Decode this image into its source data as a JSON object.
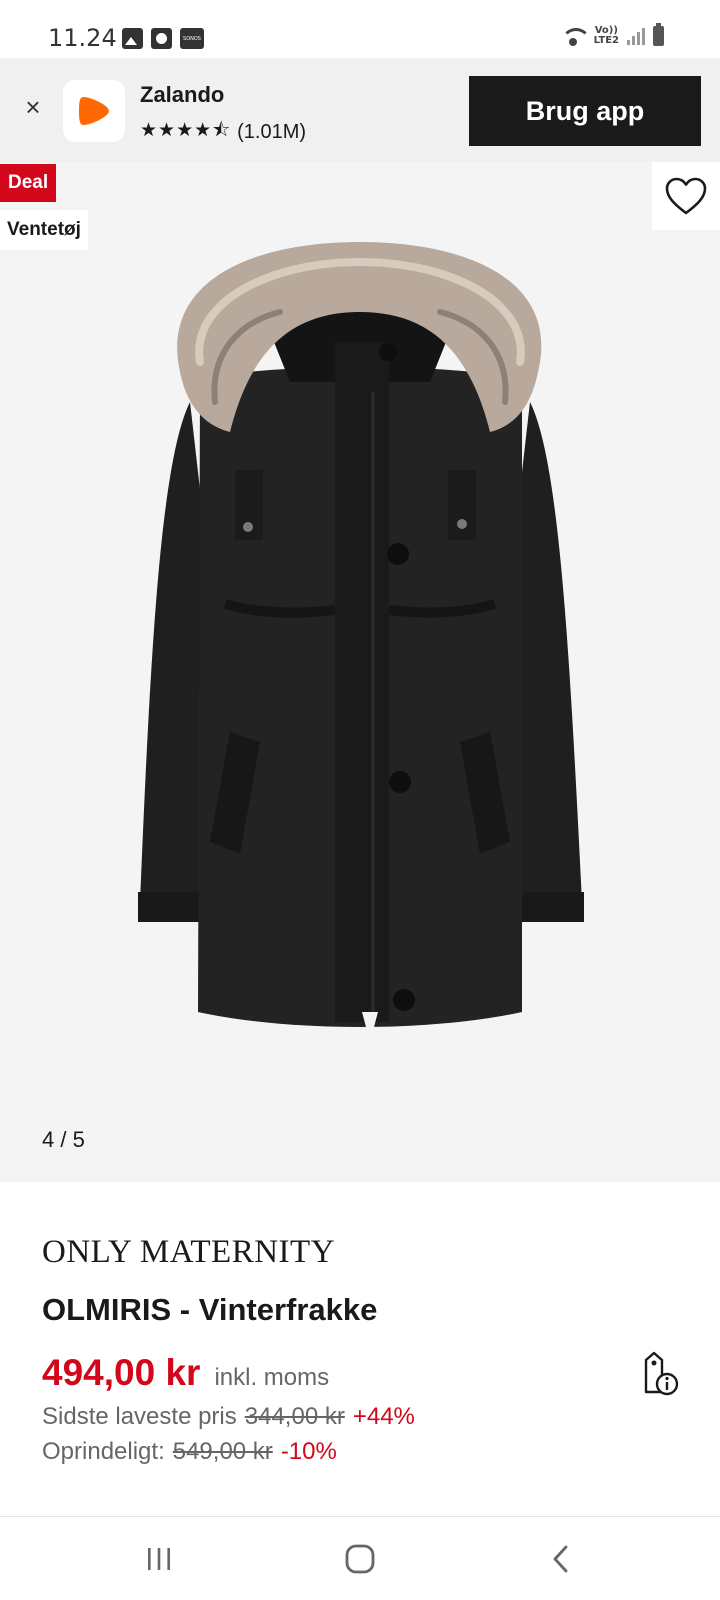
{
  "status_bar": {
    "time": "11.24",
    "left_icons": [
      "gallery-icon",
      "clock-icon",
      "sonos-icon"
    ],
    "sonos_label": "SONOS",
    "lte_top": "Vo))",
    "lte_bottom": "LTE2"
  },
  "app_banner": {
    "app_name": "Zalando",
    "stars": "★★★★⯪",
    "rating_count": "(1.01M)",
    "cta_label": "Brug app",
    "logo_color": "#ff6900"
  },
  "product_image": {
    "deal_badge": "Deal",
    "category_badge": "Ventetøj",
    "pager": "4 / 5"
  },
  "product": {
    "brand": "ONLY MATERNITY",
    "name": "OLMIRIS - Vinterfrakke",
    "price": "494,00 kr",
    "price_note": "inkl. moms",
    "lowest_label": "Sidste laveste pris",
    "lowest_price": "344,00 kr",
    "lowest_change": "+44%",
    "original_label": "Oprindeligt:",
    "original_price": "549,00 kr",
    "original_change": "-10%"
  },
  "colors": {
    "accent_red": "#d2071b",
    "dark": "#1a1a1a",
    "banner_bg": "#f0f0f0",
    "image_bg": "#f4f4f4"
  }
}
